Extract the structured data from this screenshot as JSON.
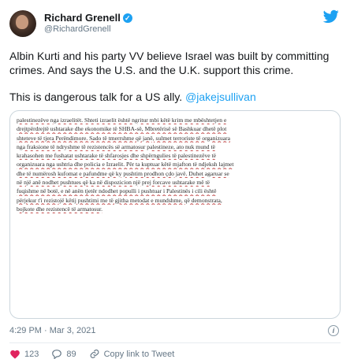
{
  "author": {
    "name": "Richard Grenell",
    "handle": "@RichardGrenell",
    "verified_mark": "✓",
    "avatar_icon": "avatar"
  },
  "tweet": {
    "paragraph1": "Albin Kurti and his party VV believe Israel was built by committing crimes. And says the U.S. and the U.K. support this crime.",
    "paragraph2_prefix": "This is dangerous talk for a US ally. ",
    "paragraph2_mention": "@jakejsullivan"
  },
  "document_lines": [
    "palestinezëve nga izraelitët. Shteti izraelit është ngritur mbi këtë krim me mbështetjen e",
    "drejtpërdrejtë ushtarake dhe ekonomike të SHBA-së, Mbretërisë së Bashkuar dhetë plot",
    "shteteve të tjera Perëndimore. Sado të tmerrshme që janë, sulmet terroriste të organizuara",
    "nga fraksione të ndryshme të rezistencës së armatosur palestineze, ato nuk mund të",
    "krahasohen me fushatat ushtarake të shfarosjes dhe shpërngulies të palestinezëve të",
    "organizuara nga ushtria dhe policia e Izraelit. Për ta kuptuar këtë mjafton të ndjeksh lajmet",
    "dhe të numërosh kufomat e pafundme që ky pushtim prodhon çdo javë. Duhet agaruar se",
    "në një anë nodhet pushtues që ka në dispozicion një prej forcave ushtarake më të",
    "fuqishme në botë, e në anën tjetër ndodhet populli i pushtuar i Palestinës i cili është",
    "përjekur t'i rezistojë këtij pushtimi me të gjitha metodat e mundshme, që demonstrata,",
    "bojkote dhe rezistencë të armatosur."
  ],
  "meta": {
    "timestamp": "4:29 PM · Mar 3, 2021",
    "info_icon": "i"
  },
  "actions": {
    "likes": "123",
    "replies": "89",
    "copy_link": "Copy link to Tweet"
  },
  "colors": {
    "accent": "#1da1f2",
    "text": "#14171a",
    "muted": "#657786",
    "like": "#e0245e"
  }
}
